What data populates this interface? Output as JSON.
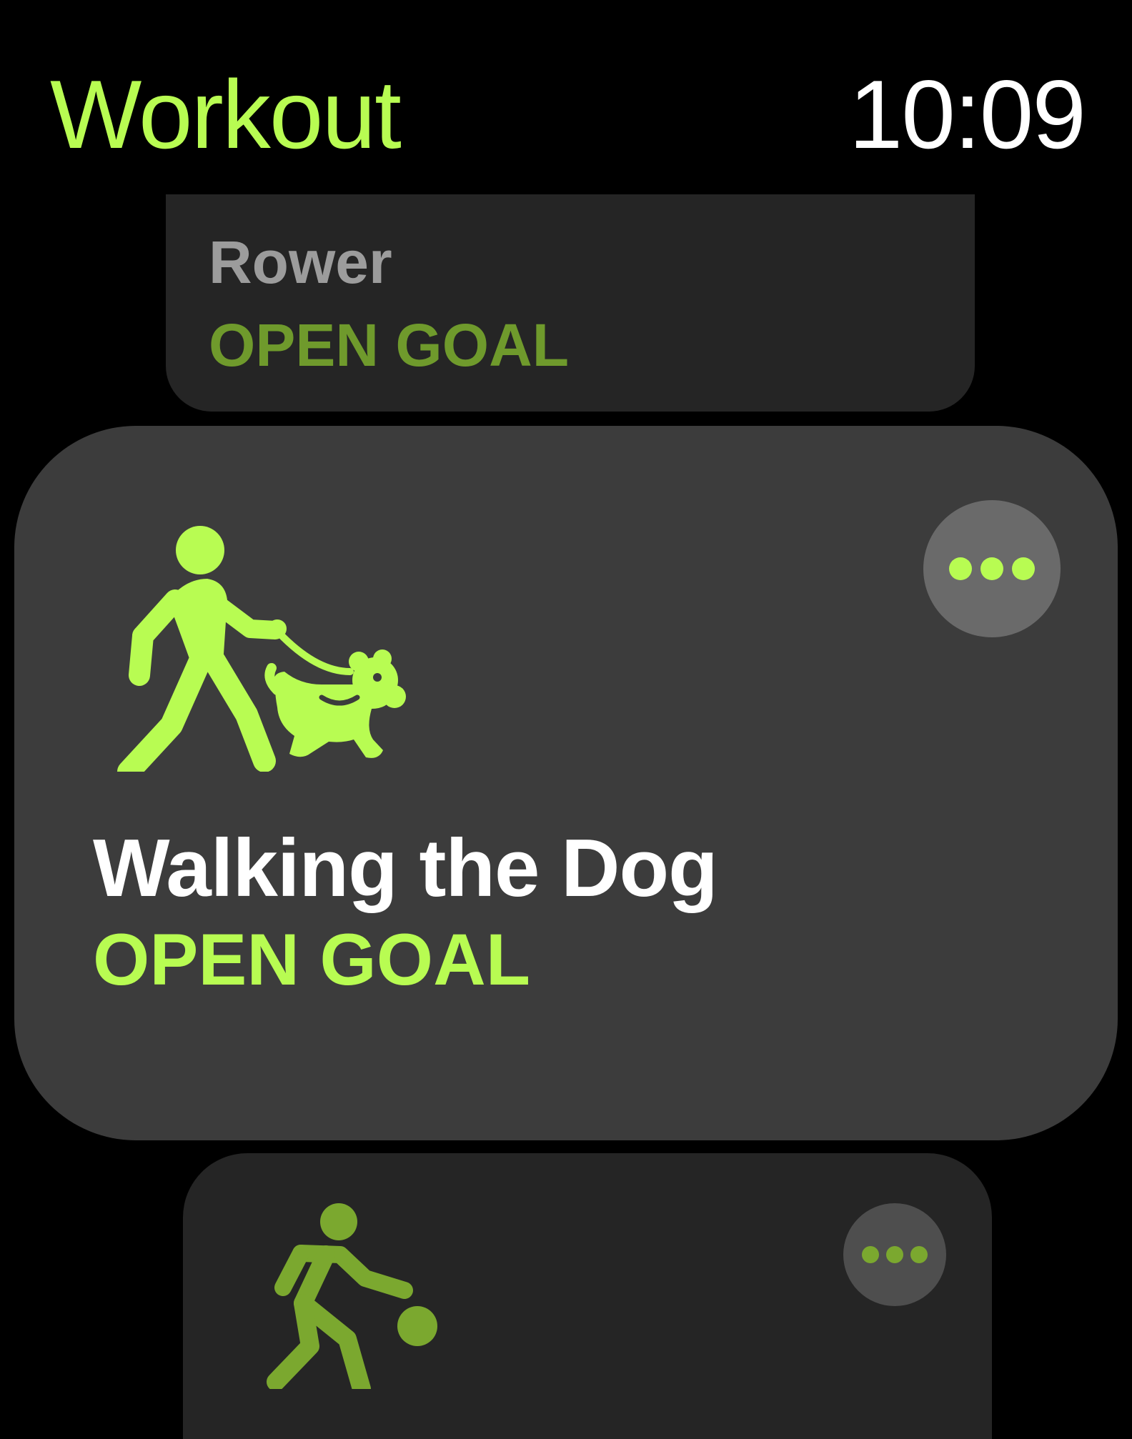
{
  "header": {
    "title": "Workout",
    "time": "10:09"
  },
  "workouts": [
    {
      "name": "Rower",
      "goal": "OPEN GOAL",
      "icon": "rower-icon"
    },
    {
      "name": "Walking the Dog",
      "goal": "OPEN GOAL",
      "icon": "walking-dog-icon",
      "focused": true
    },
    {
      "name": "",
      "goal": "",
      "icon": "basketball-player-icon"
    }
  ],
  "colors": {
    "accent": "#B8FC52",
    "accent_dim": "#6F9A2C",
    "card_focused": "#3C3C3C",
    "card": "#252525",
    "background": "#000000",
    "text_primary": "#FFFFFF",
    "text_dim": "#9C9C9C"
  }
}
